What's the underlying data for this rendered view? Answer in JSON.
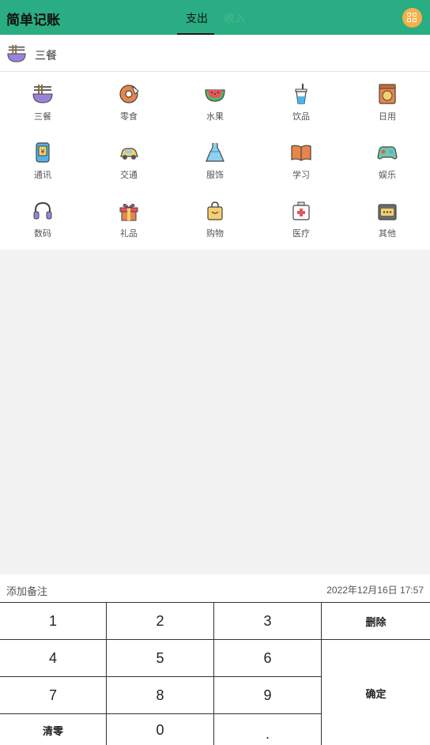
{
  "app": {
    "title": "简单记账"
  },
  "tabs": {
    "expense": "支出",
    "income": "收入"
  },
  "selected": {
    "label": "三餐"
  },
  "categories": [
    {
      "label": "三餐",
      "icon": "noodle-bowl-icon"
    },
    {
      "label": "零食",
      "icon": "donut-icon"
    },
    {
      "label": "水果",
      "icon": "watermelon-icon"
    },
    {
      "label": "饮品",
      "icon": "drink-cup-icon"
    },
    {
      "label": "日用",
      "icon": "washing-machine-icon"
    },
    {
      "label": "通讯",
      "icon": "phone-icon"
    },
    {
      "label": "交通",
      "icon": "car-icon"
    },
    {
      "label": "服饰",
      "icon": "dress-icon"
    },
    {
      "label": "学习",
      "icon": "book-icon"
    },
    {
      "label": "娱乐",
      "icon": "gamepad-icon"
    },
    {
      "label": "数码",
      "icon": "headphones-icon"
    },
    {
      "label": "礼品",
      "icon": "gift-icon"
    },
    {
      "label": "购物",
      "icon": "shopping-bag-icon"
    },
    {
      "label": "医疗",
      "icon": "medical-kit-icon"
    },
    {
      "label": "其他",
      "icon": "other-box-icon"
    }
  ],
  "note": {
    "placeholder": "添加备注",
    "datetime": "2022年12月16日 17:57"
  },
  "keypad": {
    "k1": "1",
    "k2": "2",
    "k3": "3",
    "k4": "4",
    "k5": "5",
    "k6": "6",
    "k7": "7",
    "k8": "8",
    "k9": "9",
    "k0": "0",
    "dot": ".",
    "delete": "删除",
    "confirm": "确定",
    "clear": "清零"
  },
  "colors": {
    "header": "#2aad82",
    "menu_button": "#f3b049",
    "background": "#f2f2f2"
  }
}
